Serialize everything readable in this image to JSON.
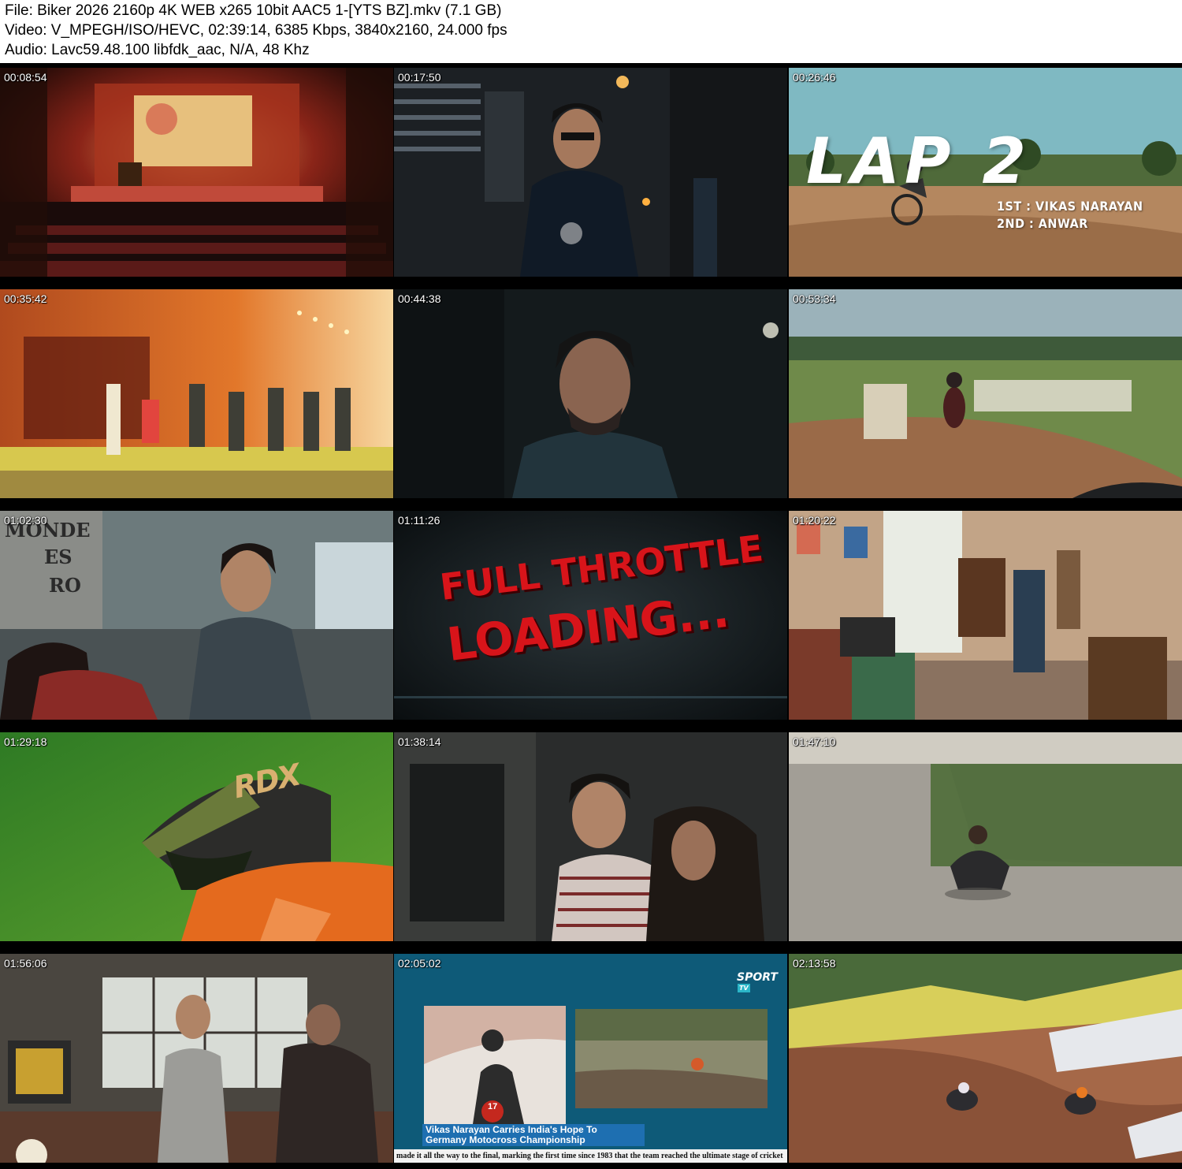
{
  "header": {
    "file_line": "File: Biker 2026 2160p 4K WEB x265 10bit AAC5 1-[YTS BZ].mkv (7.1 GB)",
    "video_line": "Video: V_MPEGH/ISO/HEVC, 02:39:14, 6385 Kbps, 3840x2160, 24.000 fps",
    "audio_line": "Audio: Lavc59.48.100 libfdk_aac, N/A, 48 Khz"
  },
  "frames": [
    {
      "timestamp": "00:08:54"
    },
    {
      "timestamp": "00:17:50"
    },
    {
      "timestamp": "00:26:46",
      "overlay": {
        "big": "LAP 2",
        "line1": "1ST : VIKAS NARAYAN",
        "line2": "2ND : ANWAR"
      }
    },
    {
      "timestamp": "00:35:42"
    },
    {
      "timestamp": "00:44:38"
    },
    {
      "timestamp": "00:53:34"
    },
    {
      "timestamp": "01:02:30",
      "overlay": {
        "sign1": "MONDE",
        "sign2": "ES",
        "sign3": "RO"
      }
    },
    {
      "timestamp": "01:11:26",
      "overlay": {
        "line1": "FULL THROTTLE",
        "line2": "LOADING..."
      }
    },
    {
      "timestamp": "01:20:22"
    },
    {
      "timestamp": "01:29:18",
      "overlay": {
        "helmet": "RDX"
      }
    },
    {
      "timestamp": "01:38:14"
    },
    {
      "timestamp": "01:47:10"
    },
    {
      "timestamp": "01:56:06"
    },
    {
      "timestamp": "02:05:02",
      "overlay": {
        "logo": "SPORT",
        "logo_badge": "TV",
        "rider_number": "17",
        "caption_line1": "Vikas Narayan Carries India's Hope To",
        "caption_line2": "Germany Motocross Championship",
        "ticker": "made it all the way to the final, marking the first time since 1983 that the team reached the ultimate stage of cricket"
      }
    },
    {
      "timestamp": "02:13:58"
    }
  ],
  "colors": {
    "header_bg": "#ffffff",
    "header_text": "#000000",
    "grid_bg": "#000000",
    "timestamp_text": "#ffffff",
    "title_red": "#d8141a",
    "news_blue": "#1e6fb1"
  }
}
